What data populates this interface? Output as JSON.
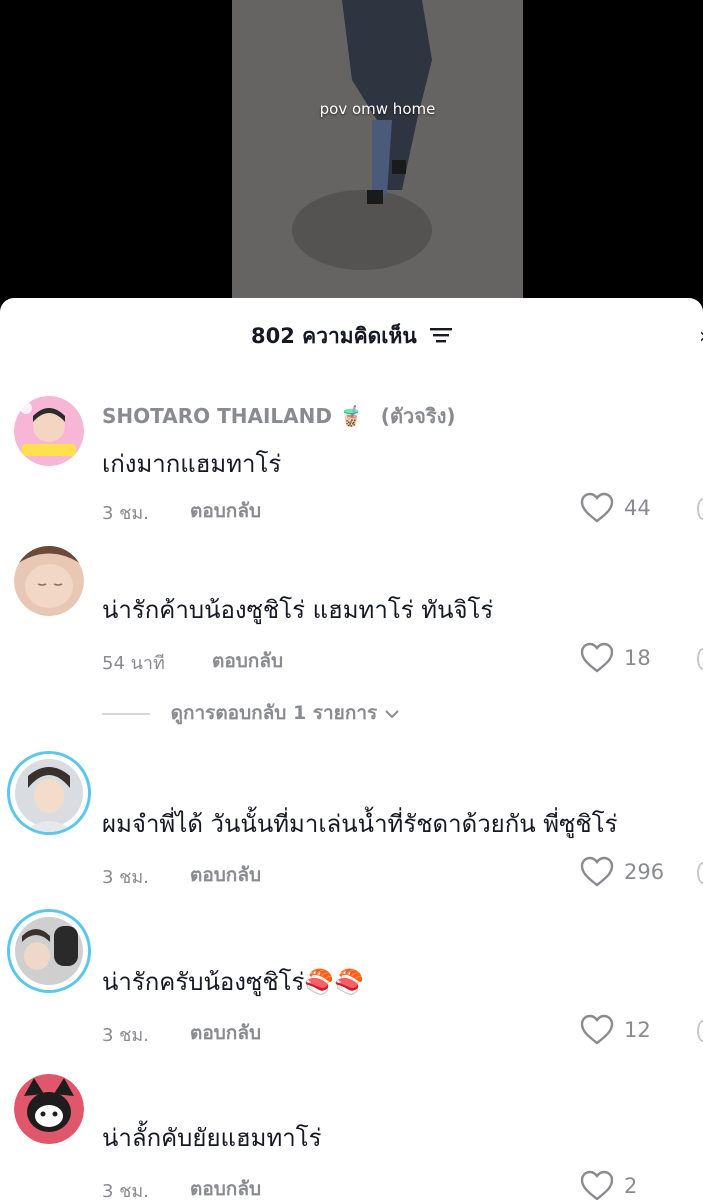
{
  "video": {
    "caption": "pov omw home"
  },
  "sheet": {
    "title": "802 ความคิดเห็น",
    "filter_icon": "filter-lines-icon"
  },
  "comments": [
    {
      "username": "SHOTARO THAILAND",
      "emoji": "🧋",
      "verified": "(ตัวจริง)",
      "text": "เก่งมากแฮมทาโร่",
      "time": "3 ชม.",
      "reply": "ตอบกลับ",
      "likes": "44"
    },
    {
      "username": "",
      "text": "น่ารักค้าบน้องซูชิโร่ แฮมทาโร่ ทันจิโร่",
      "time": "54 นาที",
      "reply": "ตอบกลับ",
      "likes": "18"
    },
    {
      "username": "",
      "text": "ผมจำพี่ได้ วันนั้นที่มาเล่นน้ำที่รัชดาด้วยกัน พี่ซูชิโร่",
      "time": "3 ชม.",
      "reply": "ตอบกลับ",
      "likes": "296"
    },
    {
      "username": "",
      "text": "น่ารักครับน้องซูชิโร่",
      "emoji": "🍣🍣",
      "time": "3 ชม.",
      "reply": "ตอบกลับ",
      "likes": "12"
    },
    {
      "username": "",
      "text": "น่าลั้กคับยัยแฮมทาโร่",
      "time": "3 ชม.",
      "reply": "ตอบกลับ",
      "likes": "2"
    }
  ],
  "view_replies": {
    "label": "ดูการตอบกลับ 1 รายการ"
  },
  "colors": {
    "muted": "#8a8b91",
    "text": "#161823",
    "ring": "#5cc8e8"
  }
}
